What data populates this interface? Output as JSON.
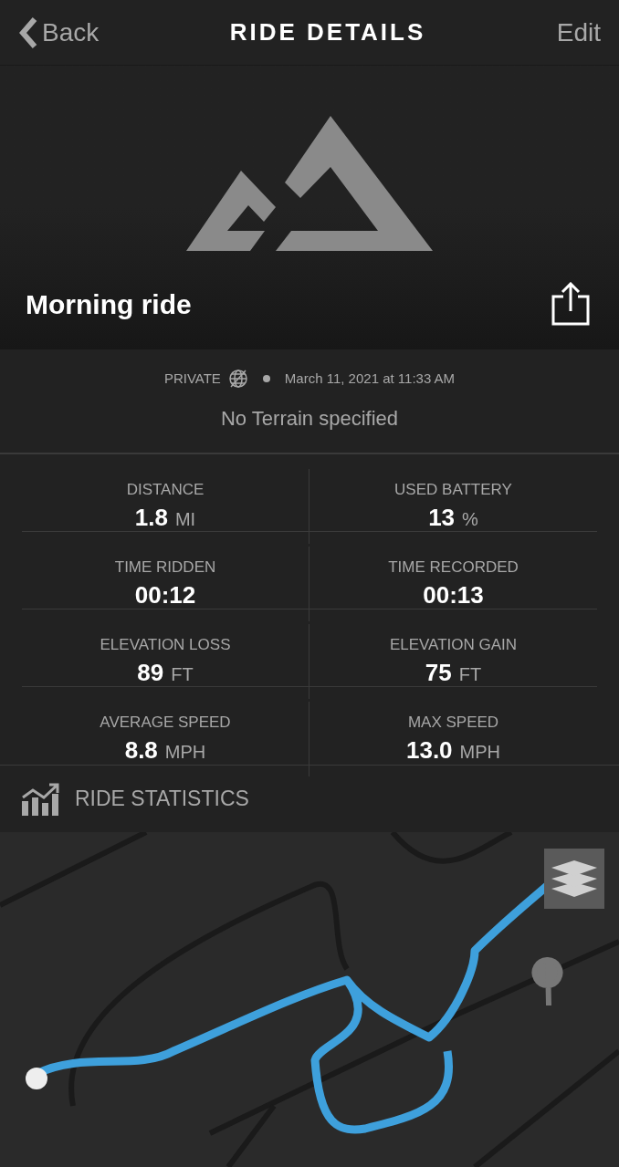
{
  "header": {
    "back": "Back",
    "title": "RIDE DETAILS",
    "edit": "Edit"
  },
  "ride": {
    "title": "Morning ride"
  },
  "meta": {
    "privacy": "PRIVATE",
    "date": "March 11, 2021 at 11:33 AM",
    "terrain": "No Terrain specified"
  },
  "stats": [
    {
      "label": "DISTANCE",
      "value": "1.8",
      "unit": "MI"
    },
    {
      "label": "USED BATTERY",
      "value": "13",
      "unit": "%"
    },
    {
      "label": "TIME RIDDEN",
      "value": "00:12"
    },
    {
      "label": "TIME RECORDED",
      "value": "00:13"
    },
    {
      "label": "ELEVATION LOSS",
      "value": "89",
      "unit": "FT"
    },
    {
      "label": "ELEVATION GAIN",
      "value": "75",
      "unit": "FT"
    },
    {
      "label": "AVERAGE SPEED",
      "value": "8.8",
      "unit": "MPH"
    },
    {
      "label": "MAX SPEED",
      "value": "13.0",
      "unit": "MPH"
    }
  ],
  "statistics_link": {
    "label": "RIDE STATISTICS"
  }
}
